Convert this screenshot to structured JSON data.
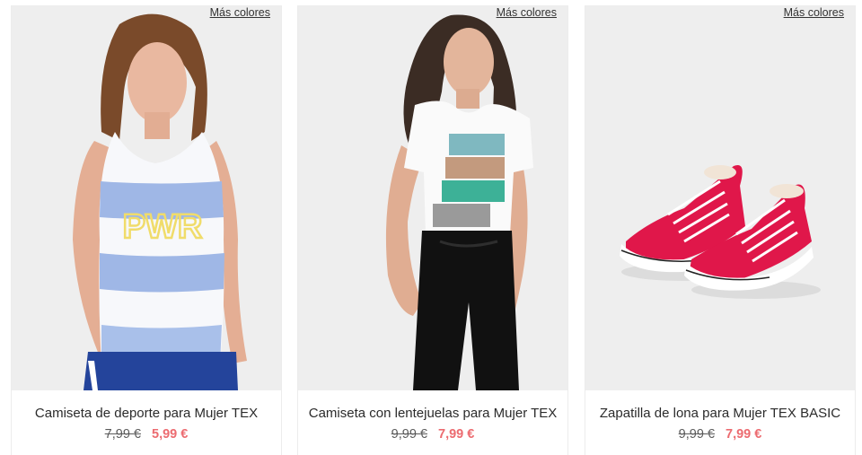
{
  "products": [
    {
      "more_colors": "Más colores",
      "title": "Camiseta de deporte para Mujer TEX",
      "old_price": "7,99 €",
      "new_price": "5,99 €",
      "shirt_print": "PWR"
    },
    {
      "more_colors": "Más colores",
      "title": "Camiseta con lentejuelas para Mujer TEX",
      "old_price": "9,99 €",
      "new_price": "7,99 €"
    },
    {
      "more_colors": "Más colores",
      "title": "Zapatilla de lona para Mujer TEX BASIC",
      "old_price": "9,99 €",
      "new_price": "7,99 €"
    }
  ],
  "colors": {
    "sale_price": "#ec6b70",
    "image_bg": "#eeeeee",
    "sneaker_red": "#e0174a"
  }
}
